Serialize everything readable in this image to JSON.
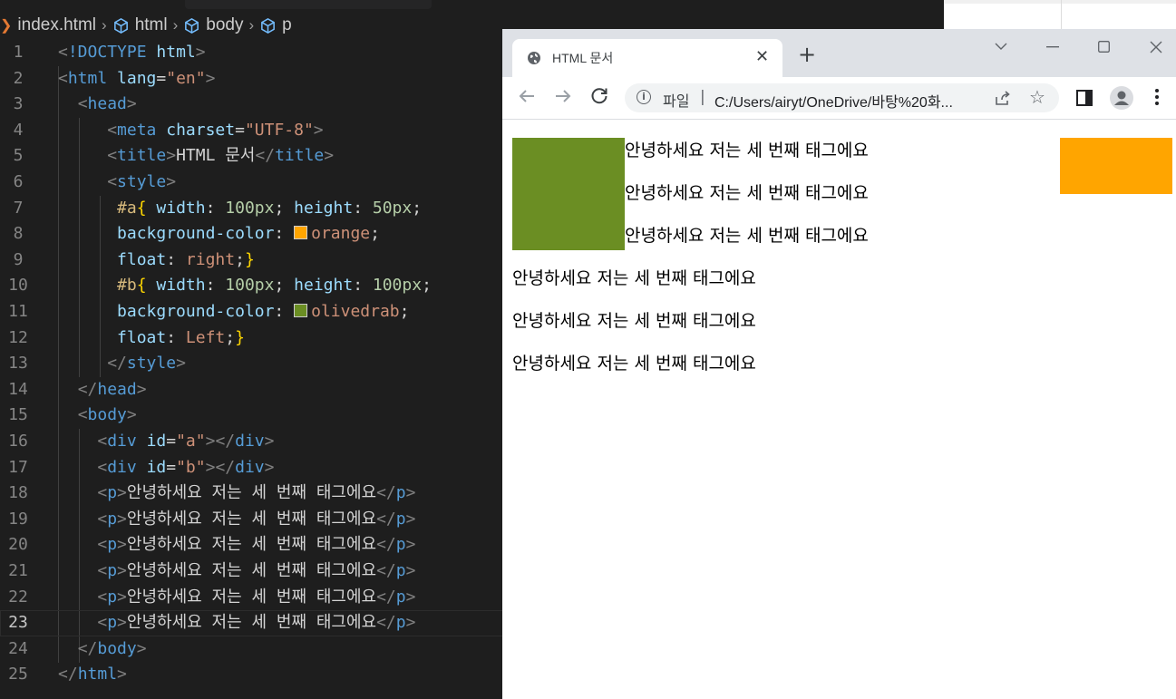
{
  "editor": {
    "breadcrumb": {
      "file": "index.html",
      "items": [
        "html",
        "body",
        "p"
      ]
    },
    "line_numbers": [
      "1",
      "2",
      "3",
      "4",
      "5",
      "6",
      "7",
      "8",
      "9",
      "10",
      "11",
      "12",
      "13",
      "14",
      "15",
      "16",
      "17",
      "18",
      "19",
      "20",
      "21",
      "22",
      "23",
      "24",
      "25"
    ],
    "current_line": "23",
    "code": {
      "doctype_open": "<!DOCTYPE",
      "doctype_html": "html",
      "lang_value": "\"en\"",
      "charset_value": "\"UTF-8\"",
      "title_text": "HTML 문서",
      "sel_a": "#a",
      "sel_b": "#b",
      "width_100": "100px",
      "height_50": "50px",
      "height_100": "100px",
      "orange": "orange",
      "olivedrab": "olivedrab",
      "float_right": "right",
      "float_left": "Left",
      "id_a": "\"a\"",
      "id_b": "\"b\"",
      "p_text": "안녕하세요 저는 세 번째 태그에요"
    },
    "colors": {
      "orange": "#ffa500",
      "olivedrab": "#6b8e23"
    }
  },
  "browser": {
    "tab_title": "HTML 문서",
    "file_label": "파일",
    "url": "C:/Users/airyt/OneDrive/바탕%20화...",
    "paragraphs": [
      "안녕하세요 저는 세 번째 태그에요",
      "안녕하세요 저는 세 번째 태그에요",
      "안녕하세요 저는 세 번째 태그에요",
      "안녕하세요 저는 세 번째 태그에요",
      "안녕하세요 저는 세 번째 태그에요",
      "안녕하세요 저는 세 번째 태그에요"
    ],
    "icons": [
      "globe-icon",
      "close-icon",
      "plus-icon",
      "chevron-down-icon",
      "minimize-icon",
      "maximize-icon",
      "window-close-icon",
      "back-arrow-icon",
      "forward-arrow-icon",
      "reload-icon",
      "info-icon",
      "share-icon",
      "star-icon",
      "side-panel-icon",
      "profile-icon",
      "more-icon"
    ]
  }
}
